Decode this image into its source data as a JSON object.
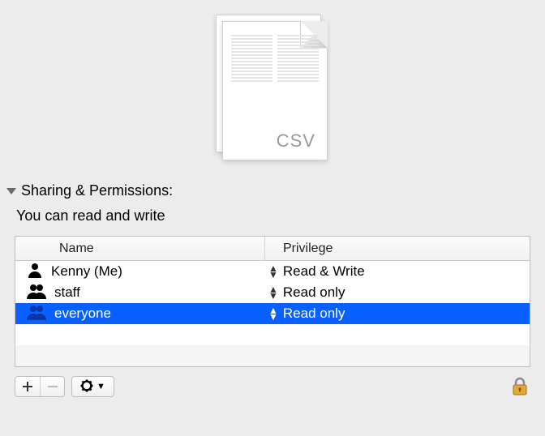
{
  "file_type_label": "CSV",
  "section_title": "Sharing & Permissions:",
  "status_text": "You can read and write",
  "columns": {
    "name": "Name",
    "privilege": "Privilege"
  },
  "rows": [
    {
      "icon": "person",
      "name": "Kenny (Me)",
      "privilege": "Read & Write",
      "selected": false
    },
    {
      "icon": "group",
      "name": "staff",
      "privilege": "Read only",
      "selected": false
    },
    {
      "icon": "world",
      "name": "everyone",
      "privilege": "Read only",
      "selected": true
    }
  ],
  "buttons": {
    "add_tooltip": "Add",
    "remove_tooltip": "Remove",
    "action_tooltip": "Action",
    "lock_tooltip": "Click the lock to make changes"
  }
}
